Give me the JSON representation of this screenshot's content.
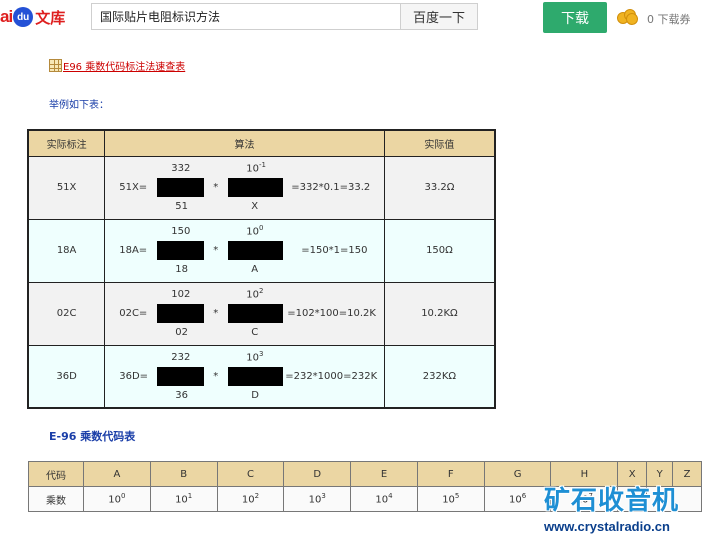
{
  "header": {
    "logo": {
      "ai": "ai",
      "du": "du",
      "wenku": "文库"
    },
    "search_value": "国际贴片电阻标识方法",
    "search_button": "百度一下",
    "download_button": "下载",
    "ticket_text": "0 下载券"
  },
  "content": {
    "link_text": "E96 乘数代码标注法速查表",
    "example_text": "举例如下表：",
    "main_table": {
      "headers": [
        "实际标注",
        "算法",
        "实际值"
      ],
      "rows": [
        {
          "label": "51X",
          "lhs": "51X=",
          "top1": "332",
          "bot1": "51",
          "star": "*",
          "top2_base": "10",
          "top2_exp": "-1",
          "bot2": "X",
          "result": "=332*0.1=33.2",
          "value": "33.2Ω"
        },
        {
          "label": "18A",
          "lhs": "18A=",
          "top1": "150",
          "bot1": "18",
          "star": "*",
          "top2_base": "10",
          "top2_exp": "0",
          "bot2": "A",
          "result": "=150*1=150",
          "value": "150Ω"
        },
        {
          "label": "02C",
          "lhs": "02C=",
          "top1": "102",
          "bot1": "02",
          "star": "*",
          "top2_base": "10",
          "top2_exp": "2",
          "bot2": "C",
          "result": "=102*100=10.2K",
          "value": "10.2KΩ"
        },
        {
          "label": "36D",
          "lhs": "36D=",
          "top1": "232",
          "bot1": "36",
          "star": "*",
          "top2_base": "10",
          "top2_exp": "3",
          "bot2": "D",
          "result": "=232*1000=232K",
          "value": "232KΩ"
        }
      ]
    },
    "e96_title": "E-96 乘数代码表",
    "code_table": {
      "row1_label": "代码",
      "row2_label": "乘数",
      "columns": [
        {
          "code": "A",
          "base": "10",
          "exp": "0"
        },
        {
          "code": "B",
          "base": "10",
          "exp": "1"
        },
        {
          "code": "C",
          "base": "10",
          "exp": "2"
        },
        {
          "code": "D",
          "base": "10",
          "exp": "3"
        },
        {
          "code": "E",
          "base": "10",
          "exp": "4"
        },
        {
          "code": "F",
          "base": "10",
          "exp": "5"
        },
        {
          "code": "G",
          "base": "10",
          "exp": "6"
        },
        {
          "code": "H",
          "base": "10",
          "exp": "7"
        },
        {
          "code": "X",
          "base": "",
          "exp": ""
        },
        {
          "code": "Y",
          "base": "",
          "exp": ""
        },
        {
          "code": "Z",
          "base": "",
          "exp": ""
        }
      ]
    }
  },
  "watermark": {
    "cn": "矿石收音机",
    "url": "www.crystalradio.cn"
  },
  "colors": {
    "accent_red": "#de1e1e",
    "download_green": "#2eaa6d",
    "header_tan": "#ebd6a3",
    "title_blue": "#1a3ea8"
  }
}
